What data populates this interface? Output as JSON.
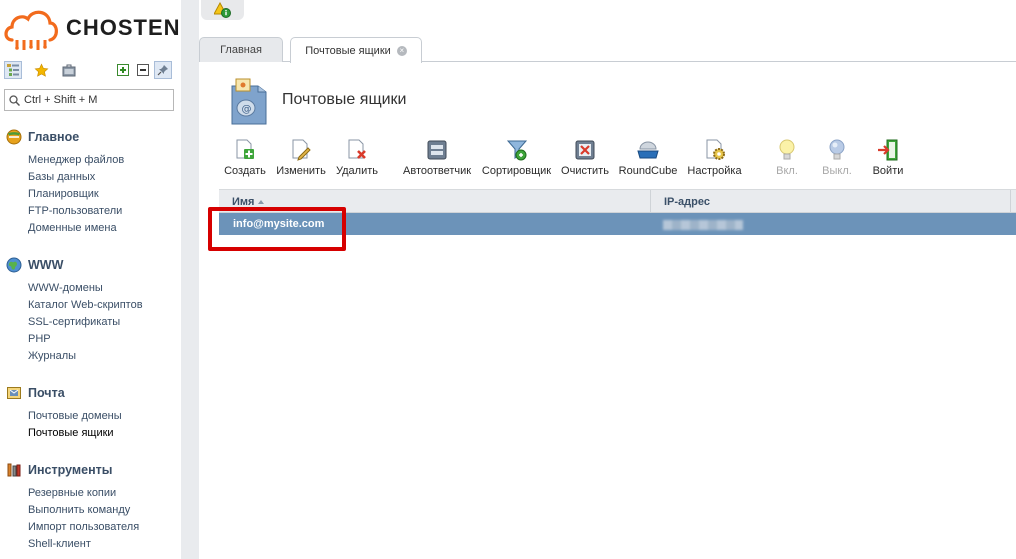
{
  "brand": {
    "name": "CHOSTEN"
  },
  "search": {
    "placeholder": "Ctrl + Shift + M"
  },
  "sidebar": {
    "sections": [
      {
        "title": "Главное",
        "icon": "globe-home-icon",
        "items": [
          "Менеджер файлов",
          "Базы данных",
          "Планировщик",
          "FTP-пользователи",
          "Доменные имена"
        ]
      },
      {
        "title": "WWW",
        "icon": "www-globe-icon",
        "items": [
          "WWW-домены",
          "Каталог Web-скриптов",
          "SSL-сертификаты",
          "PHP",
          "Журналы"
        ]
      },
      {
        "title": "Почта",
        "icon": "mail-icon",
        "items": [
          "Почтовые домены",
          "Почтовые ящики"
        ]
      },
      {
        "title": "Инструменты",
        "icon": "tools-icon",
        "items": [
          "Резервные копии",
          "Выполнить команду",
          "Импорт пользователя",
          "Shell-клиент"
        ]
      }
    ],
    "active_item": "Почтовые ящики"
  },
  "tabs": [
    {
      "label": "Главная"
    },
    {
      "label": "Почтовые ящики"
    }
  ],
  "page": {
    "title": "Почтовые ящики"
  },
  "toolbar": {
    "create": "Создать",
    "edit": "Изменить",
    "delete": "Удалить",
    "autoreply": "Автоответчик",
    "sorter": "Сортировщик",
    "clear": "Очистить",
    "roundcube": "RoundCube",
    "settings": "Настройка",
    "enable": "Вкл.",
    "disable": "Выкл.",
    "login": "Войти"
  },
  "table": {
    "columns": {
      "name": "Имя",
      "ip": "IP-адрес"
    },
    "rows": [
      {
        "name": "info@mysite.com"
      }
    ]
  },
  "colors": {
    "selected_row": "#6c93b9",
    "highlight": "#d60000",
    "logo_orange": "#f26b1d"
  }
}
